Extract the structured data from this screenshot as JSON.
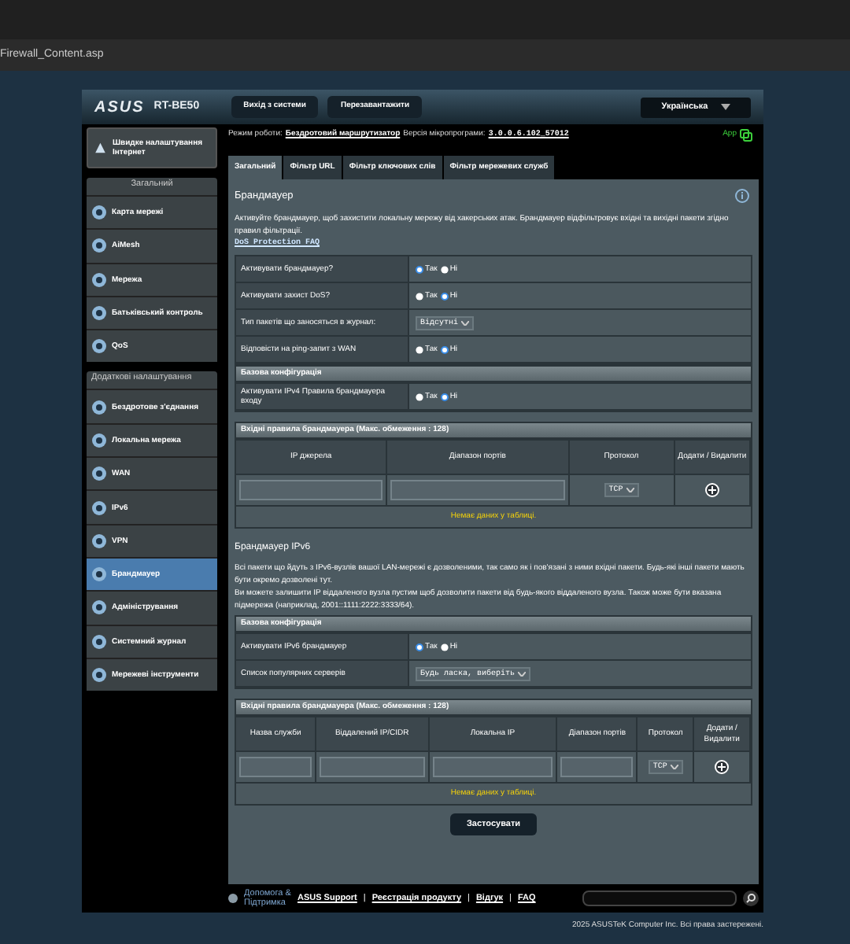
{
  "browser": {
    "address": "Firewall_Content.asp"
  },
  "header": {
    "logo": "ASUS",
    "model": "RT-BE50",
    "buttons": [
      "Вихід з системи",
      "Перезавантажити"
    ],
    "language": "Українська"
  },
  "status": {
    "mode_label": "Режим роботи:",
    "mode": "Бездротовий маршрутизатор",
    "fw_label": "Версія мікропрограми:",
    "fw": "3.0.0.6.102_57012",
    "app": "App"
  },
  "sidebar": {
    "quick_setup": "Швидке налаштування Інтернет",
    "sections": [
      {
        "title": "Загальний",
        "items": [
          {
            "label": "Карта мережі",
            "selected": false
          },
          {
            "label": "AiMesh",
            "selected": false
          },
          {
            "label": "Мережа",
            "selected": false
          },
          {
            "label": "Батьківський контроль",
            "selected": false
          },
          {
            "label": "QoS",
            "selected": false
          }
        ]
      },
      {
        "title": "Додаткові налаштування",
        "items": [
          {
            "label": "Бездротове з'єднання",
            "selected": false
          },
          {
            "label": "Локальна мережа",
            "selected": false
          },
          {
            "label": "WAN",
            "selected": false
          },
          {
            "label": "IPv6",
            "selected": false
          },
          {
            "label": "VPN",
            "selected": false
          },
          {
            "label": "Брандмауер",
            "selected": true
          },
          {
            "label": "Адміністрування",
            "selected": false
          },
          {
            "label": "Системний журнал",
            "selected": false
          },
          {
            "label": "Мережеві інструменти",
            "selected": false
          }
        ]
      }
    ]
  },
  "tabs": [
    {
      "label": "Загальний",
      "selected": true
    },
    {
      "label": "Фільтр URL",
      "selected": false
    },
    {
      "label": "Фільтр ключових слів",
      "selected": false
    },
    {
      "label": "Фільтр мережевих служб",
      "selected": false
    }
  ],
  "content": {
    "title": "Брандмауер",
    "description": "Активуйте брандмауер, щоб захистити локальну мережу від хакерських атак. Брандмауер відфільтровує вхідні та вихідні пакети згідно правил фільтрації.",
    "faq_link": "DoS Protection FAQ",
    "blocks": [
      {
        "kind": "settings",
        "rows": [
          {
            "kind": "radio",
            "label": "Активувати брандмауер?",
            "options": [
              {
                "label": "Так",
                "selected": true
              },
              {
                "label": "Ні",
                "selected": false
              }
            ]
          },
          {
            "kind": "radio",
            "label": "Активувати захист DoS?",
            "options": [
              {
                "label": "Так",
                "selected": false
              },
              {
                "label": "Ні",
                "selected": true
              }
            ]
          },
          {
            "kind": "select",
            "label": "Тип пакетів що заносяться в журнал:",
            "value": "Відсутні"
          },
          {
            "kind": "radio",
            "label": "Відповісти на ping-запит з WAN",
            "options": [
              {
                "label": "Так",
                "selected": false
              },
              {
                "label": "Ні",
                "selected": true
              }
            ]
          }
        ]
      },
      {
        "kind": "header",
        "title": "Базова конфігурація"
      },
      {
        "kind": "settings",
        "rows": [
          {
            "kind": "radio",
            "label": "Активувати IPv4 Правила брандмауера входу",
            "options": [
              {
                "label": "Так",
                "selected": false
              },
              {
                "label": "Ні",
                "selected": true
              }
            ]
          }
        ]
      },
      {
        "kind": "rules",
        "title": "Вхідні правила брандмауера (Макс. обмеження : 128)",
        "columns": [
          "IP джерела",
          "Діапазон портів",
          "Протокол",
          "Додати / Видалити"
        ],
        "protocol": "TCP",
        "empty": "Немає даних у таблиці."
      },
      {
        "kind": "section",
        "title": "Брандмауер IPv6",
        "paragraphs": [
          "Всі пакети що йдуть з IPv6-вузлів вашої LAN-мережі є дозволеними, так само як і пов'язані з ними вхідні пакети. Будь-які інші пакети мають бути окремо дозволені тут.",
          "Ви можете залишити IP віддаленого вузла пустим щоб дозволити пакети від будь-якого віддаленого вузла. Також може бути вказана підмережа (наприклад, 2001::1111:2222:3333/64)."
        ]
      },
      {
        "kind": "header",
        "title": "Базова конфігурація"
      },
      {
        "kind": "settings",
        "rows": [
          {
            "kind": "radio",
            "label": "Активувати IPv6 брандмауер",
            "options": [
              {
                "label": "Так",
                "selected": true
              },
              {
                "label": "Ні",
                "selected": false
              }
            ]
          },
          {
            "kind": "select",
            "label": "Список популярних серверів",
            "value": "Будь ласка, виберіть"
          }
        ]
      },
      {
        "kind": "rules",
        "title": "Вхідні правила брандмауера (Макс. обмеження : 128)",
        "columns": [
          "Назва служби",
          "Віддалений IP/CIDR",
          "Локальна IP",
          "Діапазон портів",
          "Протокол",
          "Додати / Видалити"
        ],
        "protocol": "TCP",
        "empty": "Немає даних у таблиці."
      }
    ],
    "apply": "Застосувати"
  },
  "footer": {
    "help": "Допомога & Підтримка",
    "links": [
      "ASUS Support",
      "Реєстрація продукту",
      "Відгук",
      "FAQ"
    ],
    "separator": "|",
    "copyright": "2025 ASUSTeK Computer Inc. Всі права застережені."
  }
}
